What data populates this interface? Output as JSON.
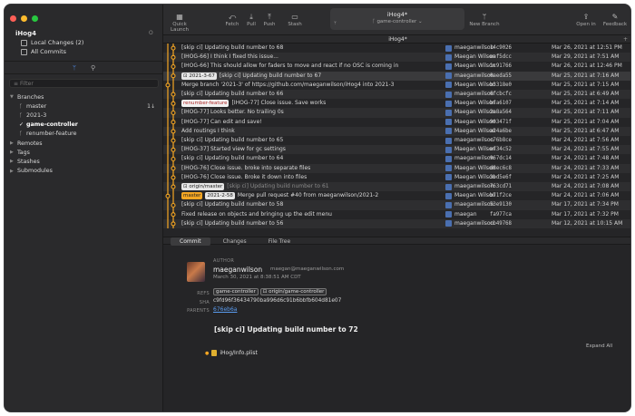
{
  "app": {
    "repo_name": "iHog4",
    "window_title": "iHog4*"
  },
  "sidebar": {
    "local_changes": "Local Changes (2)",
    "all_commits": "All Commits",
    "filter_placeholder": "Filter",
    "sections": {
      "branches": "Branches",
      "remotes": "Remotes",
      "tags": "Tags",
      "stashes": "Stashes",
      "submodules": "Submodules"
    },
    "branches": [
      {
        "name": "master",
        "ahead": "1↓"
      },
      {
        "name": "2021-3",
        "ahead": ""
      },
      {
        "name": "game-controller",
        "ahead": "",
        "current": true
      },
      {
        "name": "renumber-feature",
        "ahead": ""
      }
    ]
  },
  "toolbar": {
    "quick_launch": "Quick Launch",
    "fetch": "Fetch",
    "pull": "Pull",
    "push": "Push",
    "stash": "Stash",
    "repo_title": "iHog4*",
    "branch_selector": "game-controller",
    "new_branch": "New Branch",
    "open_in": "Open in",
    "feedback": "Feedback"
  },
  "tab": {
    "title": "iHog4*",
    "plus": "+"
  },
  "history": [
    {
      "msg": "[skip ci] Updating build number to 68",
      "author": "maeganwilson",
      "sha": "14c9026",
      "date": "Mar 26, 2021 at 12:51 PM"
    },
    {
      "msg": "[IHOG-66] I think I fixed this issue...",
      "author": "Maegan Wilson",
      "sha": "eaf5dcc",
      "date": "Mar 29, 2021 at 7:51 AM"
    },
    {
      "msg": "[IHOG-66] This should allow for faders to move and react if no OSC is coming in",
      "author": "Maegan Wilson",
      "sha": "1c91766",
      "date": "Mar 26, 2021 at 12:46 PM"
    },
    {
      "msg": "[skip ci] Updating build number to 67",
      "tag": "2021-3-67",
      "author": "maeganwilson",
      "sha": "0aeda55",
      "date": "Mar 25, 2021 at 7:16 AM"
    },
    {
      "msg": "Merge branch '2021-3' of https://github.com/maeganwilson/iHog4 into 2021-3",
      "author": "Maegan Wilson",
      "sha": "b3318e0",
      "date": "Mar 25, 2021 at 7:15 AM"
    },
    {
      "msg": "[skip ci] Updating build number to 66",
      "author": "maeganwilson",
      "sha": "6fcbcfc",
      "date": "Mar 25, 2021 at 6:49 AM"
    },
    {
      "msg": "[IHOG-77] Close issue. Save works",
      "branch": "renumber-feature",
      "author": "Maegan Wilson",
      "sha": "bfa6107",
      "date": "Mar 25, 2021 at 7:14 AM"
    },
    {
      "msg": "[IHOG-77] Looks better. No trailing 0s",
      "author": "Maegan Wilson",
      "sha": "2a8a564",
      "date": "Mar 25, 2021 at 7:11 AM"
    },
    {
      "msg": "[IHOG-77] Can edit and save!",
      "author": "Maegan Wilson",
      "sha": "903471f",
      "date": "Mar 25, 2021 at 7:04 AM"
    },
    {
      "msg": "Add routings I think",
      "author": "Maegan Wilson",
      "sha": "a24a6be",
      "date": "Mar 25, 2021 at 6:47 AM"
    },
    {
      "msg": "[skip ci] Updating build number to 65",
      "author": "maeganwilson",
      "sha": "c76b8ce",
      "date": "Mar 24, 2021 at 7:56 AM"
    },
    {
      "msg": "[IHOG-37] Started view for gc settings",
      "author": "Maegan Wilson",
      "sha": "ef34c52",
      "date": "Mar 24, 2021 at 7:55 AM"
    },
    {
      "msg": "[skip ci] Updating build number to 64",
      "author": "maeganwilson",
      "sha": "967dc14",
      "date": "Mar 24, 2021 at 7:48 AM"
    },
    {
      "msg": "[IHOG-76] Close issue. broke into separate files",
      "author": "Maegan Wilson",
      "sha": "d8ec6c8",
      "date": "Mar 24, 2021 at 7:33 AM"
    },
    {
      "msg": "[IHOG-76] Close issue. Broke it down into files",
      "author": "Maegan Wilson",
      "sha": "3bd5e6f",
      "date": "Mar 24, 2021 at 7:25 AM"
    },
    {
      "msg": "[skip ci] Updating build number to 61",
      "tag": "origin/master",
      "author": "maeganwilson",
      "sha": "763cd71",
      "date": "Mar 24, 2021 at 7:08 AM"
    },
    {
      "msg": "Merge pull request #40 from maeganwilson/2021-2",
      "branch": "master",
      "tag2": "2021-2-58",
      "author": "Maegan Wilson",
      "sha": "b71f2ce",
      "date": "Mar 24, 2021 at 7:06 AM"
    },
    {
      "msg": "[skip ci] Updating build number to 58",
      "author": "maeganwilson",
      "sha": "53e9130",
      "date": "Mar 17, 2021 at 7:34 PM"
    },
    {
      "msg": "Fixed release on objects and bringing up the edit menu",
      "author": "maegan",
      "sha": "fa977ca",
      "date": "Mar 17, 2021 at 7:32 PM"
    },
    {
      "msg": "[skip ci] Updating build number to 56",
      "author": "maeganwilson",
      "sha": "cb49768",
      "date": "Mar 12, 2021 at 10:15 AM"
    }
  ],
  "detail_tabs": [
    "Commit",
    "Changes",
    "File Tree"
  ],
  "commit": {
    "author_label": "AUTHOR",
    "author_name": "maeganwilson",
    "author_email": "maegan@maeganwilson.com",
    "date": "March 30, 2021 at 8:38:51 AM CDT",
    "refs_label": "REFS",
    "refs": [
      "game-controller",
      "origin/game-controller"
    ],
    "sha_label": "SHA",
    "sha": "c9fd96f36434790ba996d6c91b6bbfb604d81e07",
    "parents_label": "PARENTS",
    "parent": "676eb6a",
    "message": "[skip ci] Updating build number to 72",
    "expand_all": "Expand All",
    "file": "iHog/Info.plist"
  },
  "colors": {
    "accent": "#f5a623",
    "tag_blue": "#3b6fb8",
    "branch_red": "#d9493c",
    "link": "#5a9cf0"
  }
}
